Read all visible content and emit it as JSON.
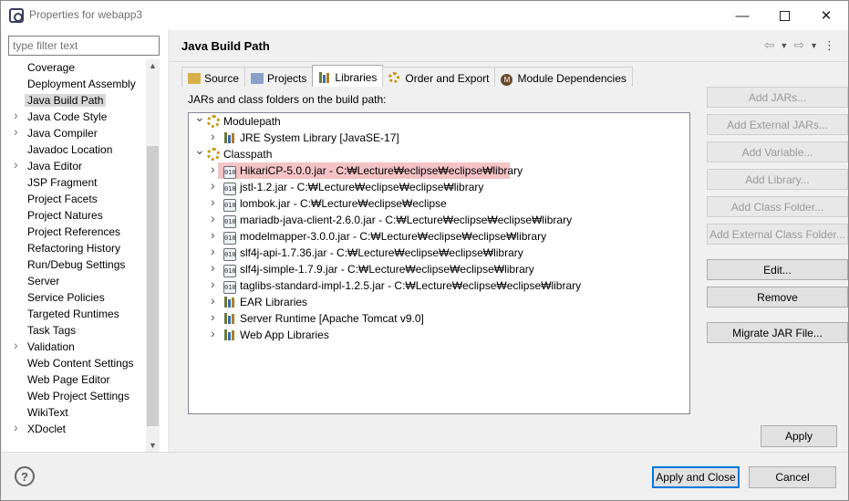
{
  "window": {
    "title": "Properties for webapp3",
    "minimize": "—",
    "close": "✕"
  },
  "filter": {
    "placeholder": "type filter text"
  },
  "sidebar": {
    "items": [
      {
        "label": "Coverage",
        "expandable": false
      },
      {
        "label": "Deployment Assembly",
        "expandable": false
      },
      {
        "label": "Java Build Path",
        "expandable": false,
        "selected": true
      },
      {
        "label": "Java Code Style",
        "expandable": true
      },
      {
        "label": "Java Compiler",
        "expandable": true
      },
      {
        "label": "Javadoc Location",
        "expandable": false
      },
      {
        "label": "Java Editor",
        "expandable": true
      },
      {
        "label": "JSP Fragment",
        "expandable": false
      },
      {
        "label": "Project Facets",
        "expandable": false
      },
      {
        "label": "Project Natures",
        "expandable": false
      },
      {
        "label": "Project References",
        "expandable": false
      },
      {
        "label": "Refactoring History",
        "expandable": false
      },
      {
        "label": "Run/Debug Settings",
        "expandable": false
      },
      {
        "label": "Server",
        "expandable": false
      },
      {
        "label": "Service Policies",
        "expandable": false
      },
      {
        "label": "Targeted Runtimes",
        "expandable": false
      },
      {
        "label": "Task Tags",
        "expandable": false
      },
      {
        "label": "Validation",
        "expandable": true
      },
      {
        "label": "Web Content Settings",
        "expandable": false
      },
      {
        "label": "Web Page Editor",
        "expandable": false
      },
      {
        "label": "Web Project Settings",
        "expandable": false
      },
      {
        "label": "WikiText",
        "expandable": false
      },
      {
        "label": "XDoclet",
        "expandable": true
      }
    ]
  },
  "page": {
    "title": "Java Build Path"
  },
  "tabs": [
    {
      "label": "Source",
      "icon": "source-folder-icon"
    },
    {
      "label": "Projects",
      "icon": "projects-icon"
    },
    {
      "label": "Libraries",
      "icon": "libraries-icon",
      "active": true
    },
    {
      "label": "Order and Export",
      "icon": "order-export-icon"
    },
    {
      "label": "Module Dependencies",
      "icon": "module-icon"
    }
  ],
  "libraries": {
    "label": "JARs and class folders on the build path:",
    "tree": [
      {
        "text": "Modulepath",
        "level": 0,
        "twisty": "open",
        "icon": "gear"
      },
      {
        "text": "JRE System Library [JavaSE-17]",
        "level": 1,
        "twisty": "closed",
        "icon": "lib"
      },
      {
        "text": "Classpath",
        "level": 0,
        "twisty": "open",
        "icon": "gear"
      },
      {
        "text": "HikariCP-5.0.0.jar - C:₩Lecture₩eclipse₩eclipse₩library",
        "level": 1,
        "twisty": "closed",
        "icon": "jar",
        "highlight": true
      },
      {
        "text": "jstl-1.2.jar - C:₩Lecture₩eclipse₩eclipse₩library",
        "level": 1,
        "twisty": "closed",
        "icon": "jar"
      },
      {
        "text": "lombok.jar - C:₩Lecture₩eclipse₩eclipse",
        "level": 1,
        "twisty": "closed",
        "icon": "jar"
      },
      {
        "text": "mariadb-java-client-2.6.0.jar - C:₩Lecture₩eclipse₩eclipse₩library",
        "level": 1,
        "twisty": "closed",
        "icon": "jar"
      },
      {
        "text": "modelmapper-3.0.0.jar - C:₩Lecture₩eclipse₩eclipse₩library",
        "level": 1,
        "twisty": "closed",
        "icon": "jar"
      },
      {
        "text": "slf4j-api-1.7.36.jar - C:₩Lecture₩eclipse₩eclipse₩library",
        "level": 1,
        "twisty": "closed",
        "icon": "jar"
      },
      {
        "text": "slf4j-simple-1.7.9.jar - C:₩Lecture₩eclipse₩eclipse₩library",
        "level": 1,
        "twisty": "closed",
        "icon": "jar"
      },
      {
        "text": "taglibs-standard-impl-1.2.5.jar - C:₩Lecture₩eclipse₩eclipse₩library",
        "level": 1,
        "twisty": "closed",
        "icon": "jar"
      },
      {
        "text": "EAR Libraries",
        "level": 1,
        "twisty": "closed",
        "icon": "lib"
      },
      {
        "text": "Server Runtime [Apache Tomcat v9.0]",
        "level": 1,
        "twisty": "closed",
        "icon": "lib"
      },
      {
        "text": "Web App Libraries",
        "level": 1,
        "twisty": "closed",
        "icon": "lib"
      }
    ],
    "buttons": [
      {
        "label": "Add JARs...",
        "enabled": false
      },
      {
        "label": "Add External JARs...",
        "enabled": false
      },
      {
        "label": "Add Variable...",
        "enabled": false
      },
      {
        "label": "Add Library...",
        "enabled": false
      },
      {
        "label": "Add Class Folder...",
        "enabled": false
      },
      {
        "label": "Add External Class Folder...",
        "enabled": false
      },
      {
        "label": "Edit...",
        "enabled": true
      },
      {
        "label": "Remove",
        "enabled": true
      },
      {
        "label": "Migrate JAR File...",
        "enabled": true
      }
    ]
  },
  "actions": {
    "apply": "Apply",
    "apply_and_close": "Apply and Close",
    "cancel": "Cancel",
    "help": "?"
  }
}
